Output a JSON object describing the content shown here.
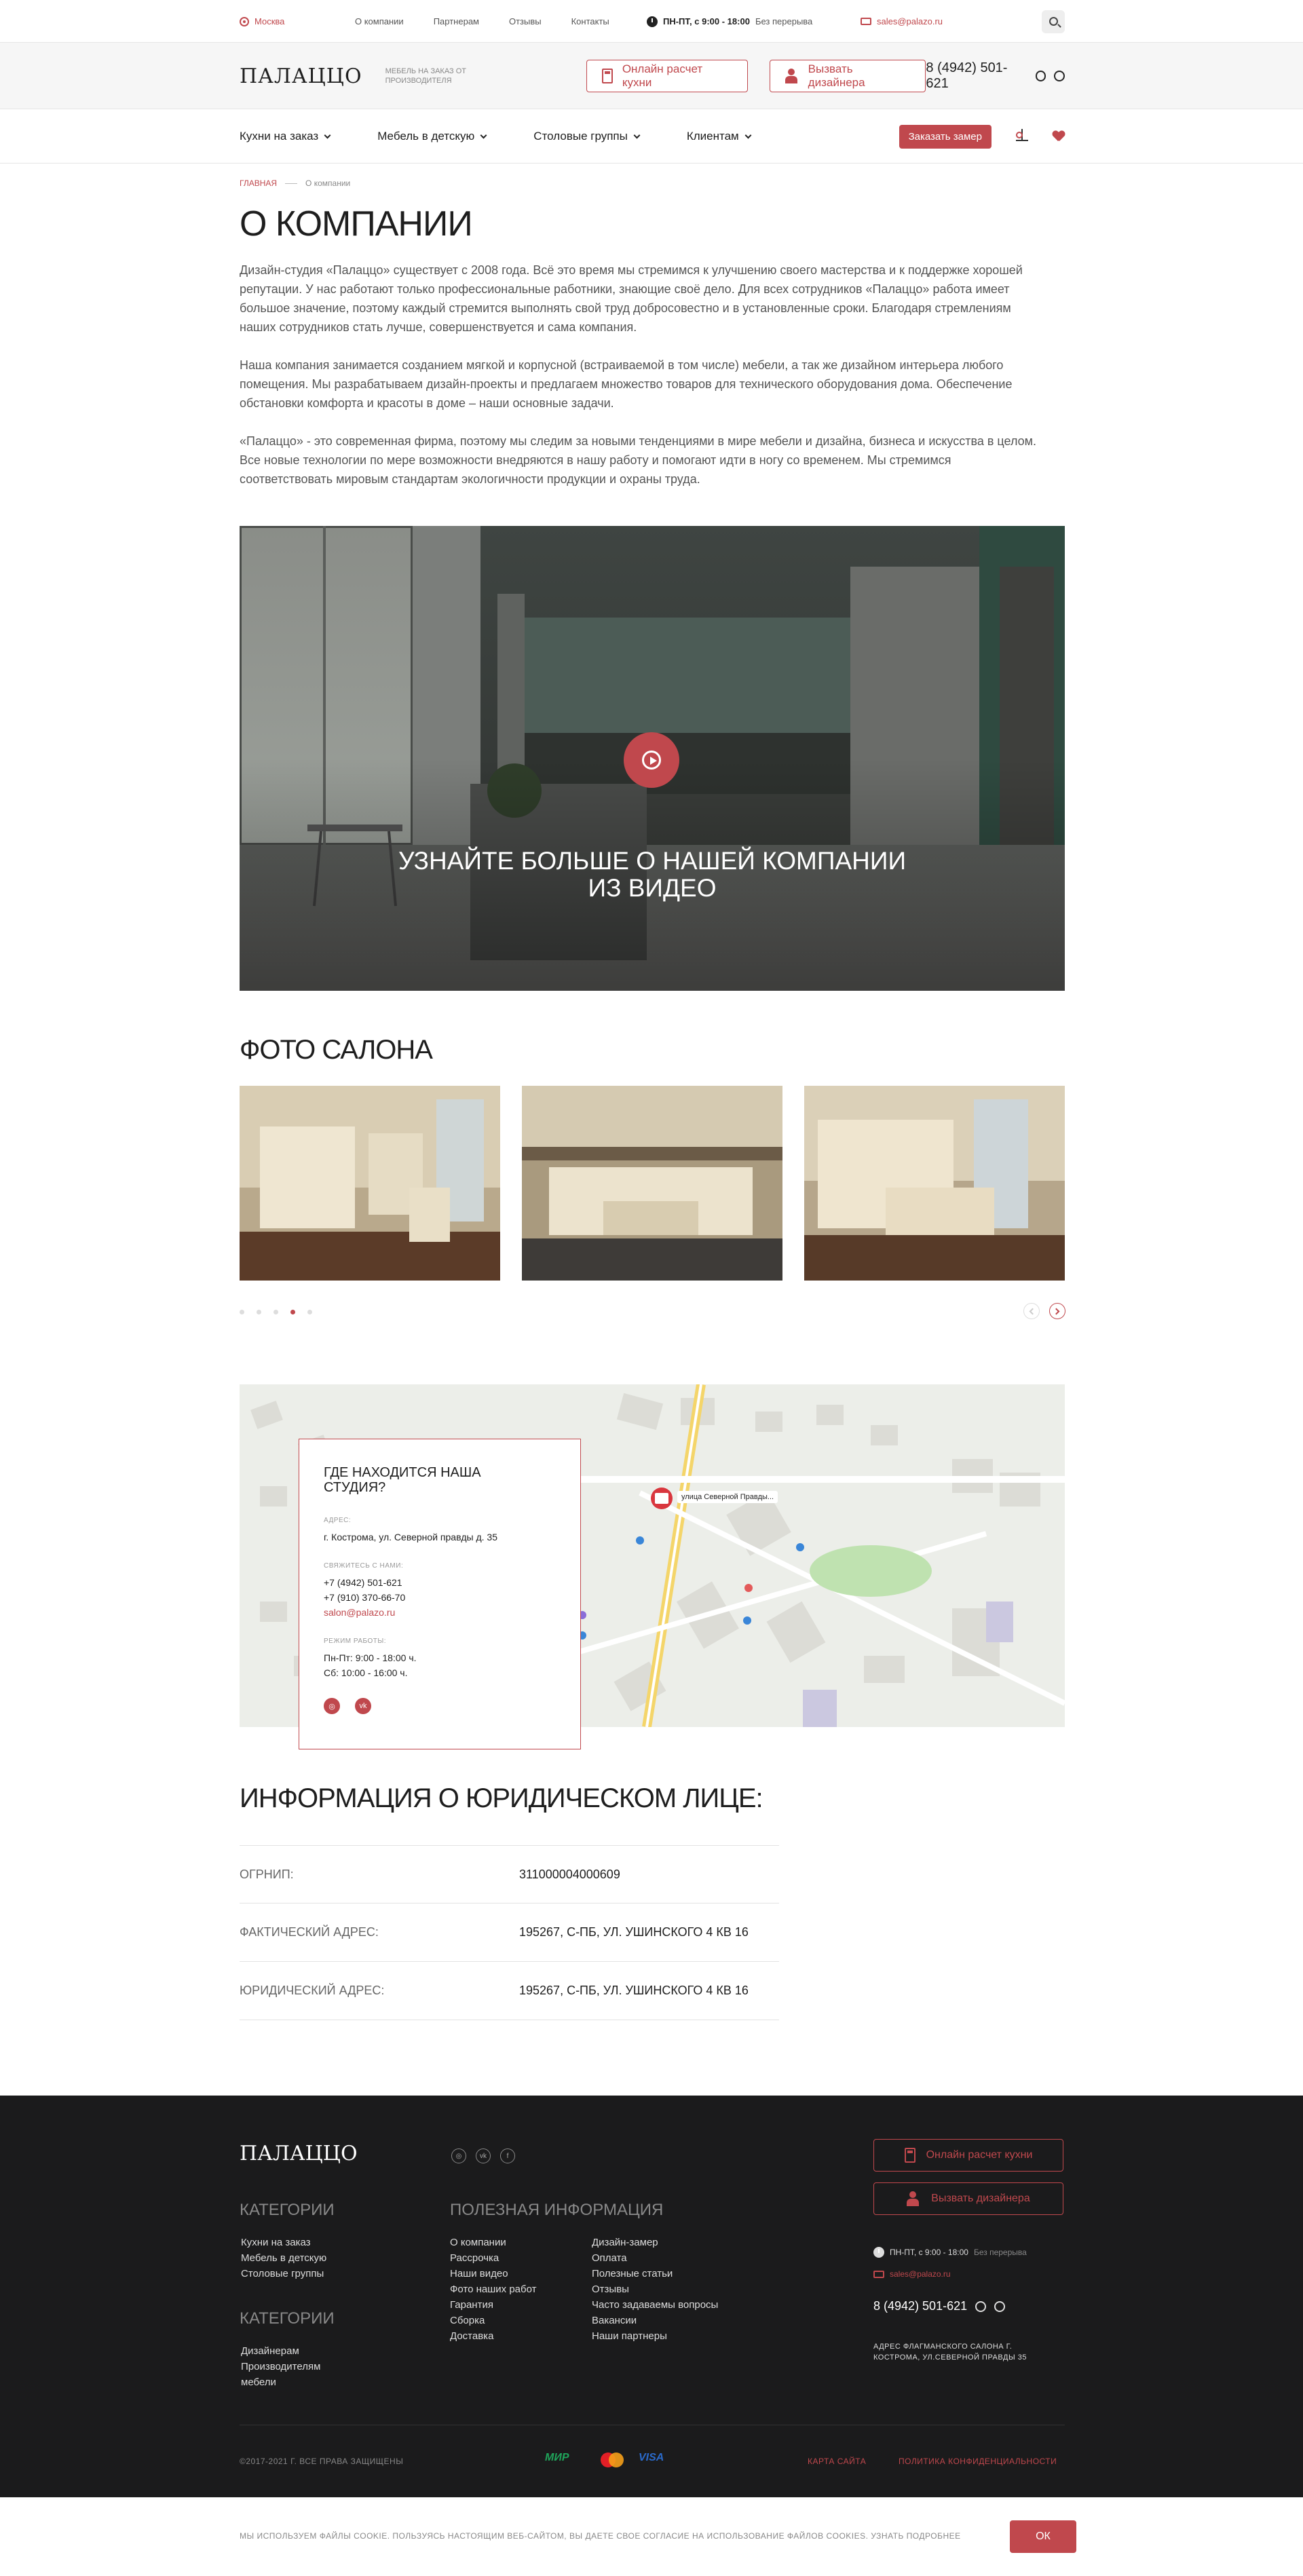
{
  "topbar": {
    "city": "Москва",
    "nav": [
      "О компании",
      "Партнерам",
      "Отзывы",
      "Контакты"
    ],
    "hours_bold": "ПН-ПТ, с 9:00 - 18:00",
    "hours_note": "Без перерыва",
    "email": "sales@palazo.ru"
  },
  "header": {
    "logo": "ПАЛАЦЦО",
    "tagline": "Мебель на заказ от производителя",
    "btn_calc": "Онлайн расчет кухни",
    "btn_designer": "Вызвать дизайнера",
    "phone": "8 (4942) 501-621"
  },
  "mainnav": {
    "items": [
      "Кухни на заказ",
      "Мебель в детскую",
      "Столовые группы",
      "Клиентам"
    ],
    "cta": "Заказать замер"
  },
  "breadcrumb": {
    "home": "Главная",
    "current": "О компании"
  },
  "page_title": "О КОМПАНИИ",
  "about": [
    "Дизайн-студия «Палаццо» существует с 2008 года. Всё это время мы стремимся к улучшению своего мастерства и к поддержке хорошей репутации. У нас работают только профессиональные работники, знающие своё дело. Для всех сотрудников «Палаццо» работа имеет большое значение, поэтому каждый стремится выполнять свой труд добросовестно и в установленные сроки. Благодаря стремлениям наших сотрудников стать лучше, совершенствуется и сама компания.",
    "Наша компания занимается созданием мягкой и корпусной (встраиваемой в том числе) мебели, а так же дизайном интерьера любого помещения. Мы разрабатываем дизайн-проекты и предлагаем множество товаров для технического оборудования дома. Обеспечение обстановки комфорта и красоты в доме – наши основные задачи.",
    "«Палаццо» - это современная фирма, поэтому мы следим за новыми тенденциями в мире мебели и дизайна, бизнеса и искусства в целом. Все новые технологии по мере возможности внедряются в нашу работу и помогают идти в ногу со временем. Мы стремимся соответствовать мировым стандартам экологичности продукции и охраны труда."
  ],
  "video": {
    "title_line1": "УЗНАЙТЕ БОЛЬШЕ О НАШЕЙ КОМПАНИИ",
    "title_line2": "ИЗ ВИДЕО"
  },
  "salon": {
    "title": "ФОТО САЛОНА",
    "slides_total": 5,
    "active_slide": 4
  },
  "map": {
    "title": "ГДЕ НАХОДИТСЯ НАША СТУДИЯ?",
    "address_label": "АДРЕС:",
    "address": "г. Кострома, ул. Северной правды д. 35",
    "contact_label": "СВЯЖИТЕСЬ С НАМИ:",
    "phone1": "+7 (4942) 501-621",
    "phone2": "+7 (910) 370-66-70",
    "email": "salon@palazo.ru",
    "hours_label": "РЕЖИМ РАБОТЫ:",
    "hours1": "Пн-Пт: 9:00 - 18:00 ч.",
    "hours2": "Сб: 10:00 - 16:00 ч.",
    "pin_label": "улица Северной Правды..."
  },
  "legal": {
    "title": "ИНФОРМАЦИЯ О ЮРИДИЧЕСКОМ ЛИЦЕ:",
    "rows": [
      {
        "k": "ОГРНИП:",
        "v": "311000004000609"
      },
      {
        "k": "ФАКТИЧЕСКИЙ АДРЕС:",
        "v": "195267, С-ПБ, ул. Ушинского 4 кв 16"
      },
      {
        "k": "ЮРИДИЧЕСКИЙ АДРЕС:",
        "v": "195267, С-ПБ, ул. Ушинского 4 кв 16"
      }
    ]
  },
  "footer": {
    "logo": "ПАЛАЦЦО",
    "cat_title": "КАТЕГОРИИ",
    "cat_items": [
      "Кухни на заказ",
      "Мебель в детскую",
      "Столовые группы"
    ],
    "cat2_title": "КАТЕГОРИИ",
    "cat2_items": [
      "Дизайнерам",
      "Производителям",
      "мебели"
    ],
    "info_title": "ПОЛЕЗНАЯ ИНФОРМАЦИЯ",
    "info_col1": [
      "О компании",
      "Рассрочка",
      "Наши видео",
      "Фото наших работ",
      "Гарантия",
      "Сборка",
      "Доставка"
    ],
    "info_col2": [
      "Дизайн-замер",
      "Оплата",
      "Полезные статьи",
      "Отзывы",
      "Часто задаваемы вопросы",
      "Вакансии",
      "Наши партнеры"
    ],
    "btn_calc": "Онлайн расчет кухни",
    "btn_designer": "Вызвать дизайнера",
    "hours_bold": "ПН-ПТ, с 9:00 - 18:00",
    "hours_note": "Без перерыва",
    "email": "sales@palazo.ru",
    "phone": "8 (4942) 501-621",
    "address": "Адрес флагманского салона г. Кострома, ул.Северной правды 35",
    "copyright": "©2017-2021 г. Все права защищены",
    "pay": [
      "МИР",
      "Mastercard",
      "VISA"
    ],
    "sitemap": "Карта сайта",
    "privacy": "Политика конфиденциальности"
  },
  "cookie": {
    "text": "Мы используем файлы cookie. Пользуясь настоящим веб-сайтом, вы даете свое согласие на использование файлов cookies. Узнать подробнее",
    "ok": "ОК"
  },
  "colors": {
    "accent": "#c0484d",
    "footer_bg": "#1b1b1c"
  }
}
